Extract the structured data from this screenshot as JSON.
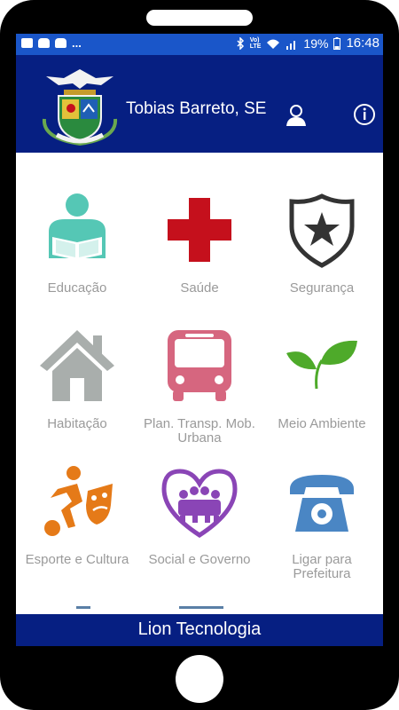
{
  "status": {
    "left_more": "...",
    "voice_lte": "Vo)\nLTE",
    "battery": "19%",
    "time": "16:48"
  },
  "header": {
    "city": "Tobias Barreto, SE",
    "user_icon": "user-icon",
    "info_icon": "info-icon",
    "bg_color": "#061f82"
  },
  "tiles": [
    {
      "label": "Educação",
      "icon": "reader-icon",
      "color": "#55c7b5"
    },
    {
      "label": "Saúde",
      "icon": "red-cross-icon",
      "color": "#c5101c"
    },
    {
      "label": "Segurança",
      "icon": "police-badge-icon",
      "color": "#333333"
    },
    {
      "label": "Habitação",
      "icon": "house-icon",
      "color": "#a9aeac"
    },
    {
      "label": "Plan. Transp. Mob.\nUrbana",
      "icon": "bus-icon",
      "color": "#d6667f"
    },
    {
      "label": "Meio Ambiente",
      "icon": "leaves-icon",
      "color": "#4eaa2a"
    },
    {
      "label": "Esporte e Cultura",
      "icon": "sports-culture-icon",
      "color": "#e57a18"
    },
    {
      "label": "Social e Governo",
      "icon": "community-heart-icon",
      "color": "#8a45b6"
    },
    {
      "label": "Ligar para\nPrefeitura",
      "icon": "telephone-icon",
      "color": "#4a86c4"
    }
  ],
  "footer": {
    "text": "Lion Tecnologia"
  }
}
